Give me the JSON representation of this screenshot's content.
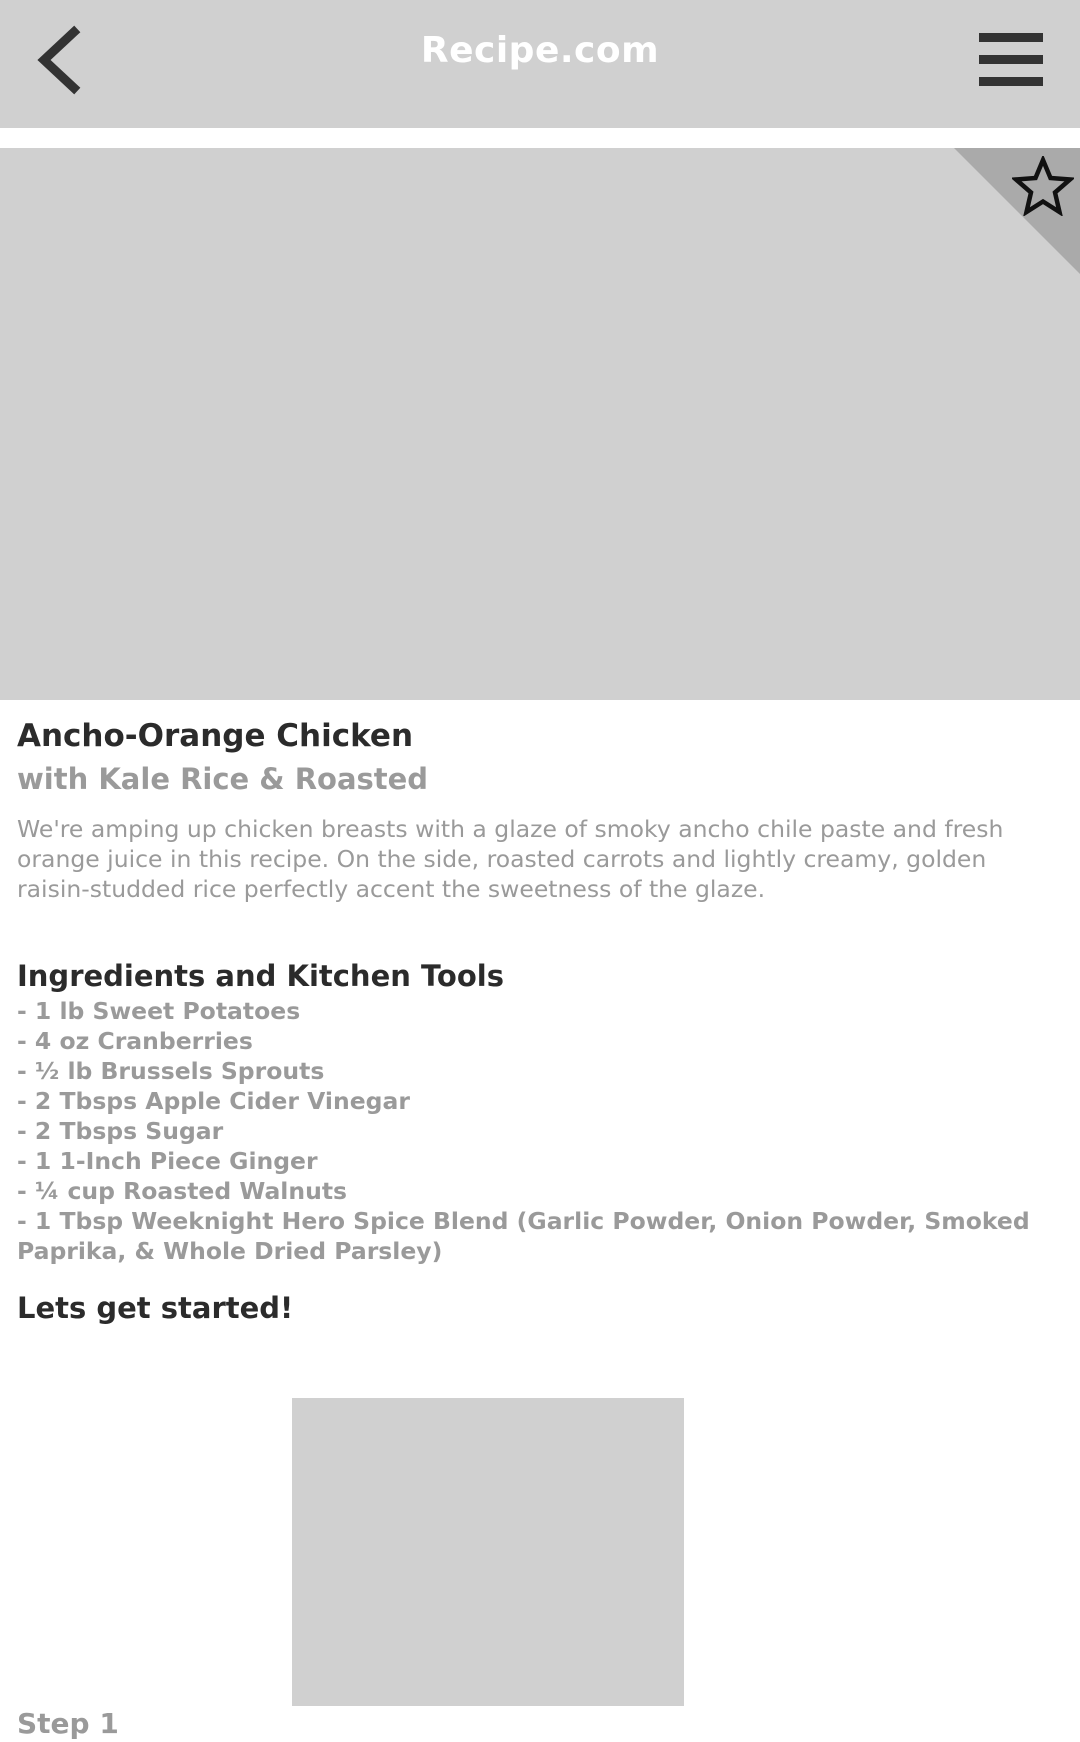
{
  "header": {
    "title": "Recipe.com",
    "back_icon": "chevron-left-icon",
    "menu_icon": "hamburger-menu-icon"
  },
  "hero": {
    "favorite_icon": "star-outline-icon"
  },
  "recipe": {
    "title": "Ancho-Orange Chicken",
    "subtitle": "with Kale Rice & Roasted",
    "description": "We're amping up chicken breasts with a glaze of smoky ancho chile paste and fresh orange juice in this recipe. On the side, roasted carrots and lightly creamy, golden raisin-studded rice perfectly accent the sweetness of the glaze."
  },
  "ingredients": {
    "heading": "Ingredients and Kitchen Tools",
    "items": [
      "- 1 lb Sweet Potatoes",
      "- 4 oz Cranberries",
      "- ½ lb Brussels Sprouts",
      "- 2 Tbsps Apple Cider Vinegar",
      "- 2 Tbsps Sugar",
      "- 1 1-Inch Piece Ginger",
      "- ¼ cup Roasted Walnuts",
      "- 1 Tbsp Weeknight Hero Spice Blend (Garlic Powder, Onion Powder, Smoked Paprika, & Whole Dried Parsley)"
    ]
  },
  "steps": {
    "heading": "Lets get started!",
    "items": [
      {
        "label": "Step 1"
      }
    ]
  },
  "colors": {
    "header_bg": "#d0d0d0",
    "placeholder": "#d0d0d0",
    "corner": "#aaaaaa",
    "dark_text": "#2b2b2b",
    "muted_text": "#9a9a9a",
    "header_text": "#ffffff"
  }
}
